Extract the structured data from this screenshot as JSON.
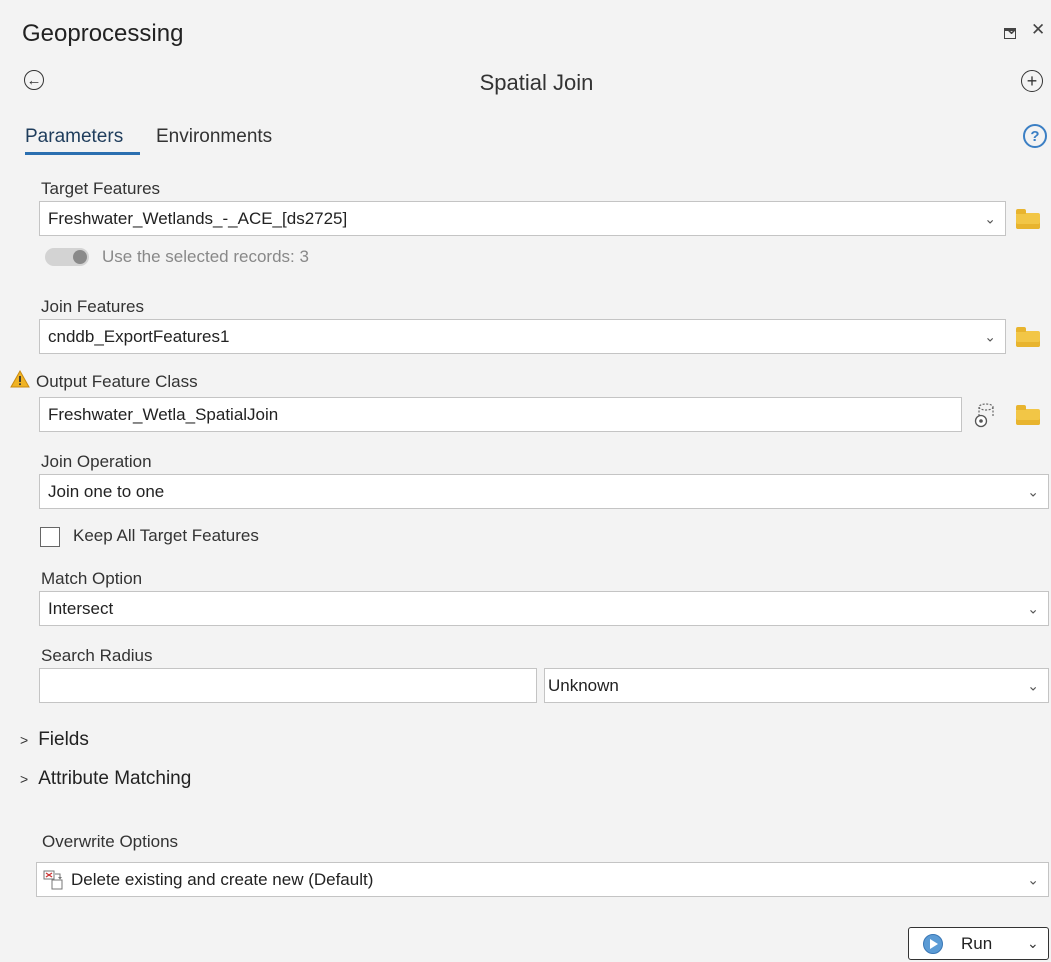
{
  "pane": {
    "title": "Geoprocessing",
    "controls": {
      "dropdown": "⌄",
      "maximize": "□",
      "close": "✕"
    }
  },
  "tool": {
    "title": "Spatial Join",
    "back_icon": "←",
    "add_icon": "+"
  },
  "tabs": [
    {
      "label": "Parameters",
      "active": true
    },
    {
      "label": "Environments",
      "active": false
    }
  ],
  "help_icon": "?",
  "params": {
    "target_features": {
      "label": "Target Features",
      "value": "Freshwater_Wetlands_-_ACE_[ds2725]",
      "toggle_label": "Use the selected records: 3",
      "toggle_on": false
    },
    "join_features": {
      "label": "Join Features",
      "value": "cnddb_ExportFeatures1"
    },
    "output_feature_class": {
      "label": "Output Feature Class",
      "value": "Freshwater_Wetla_SpatialJoin"
    },
    "join_operation": {
      "label": "Join Operation",
      "value": "Join one to one"
    },
    "keep_all": {
      "label": "Keep All Target Features",
      "checked": false
    },
    "match_option": {
      "label": "Match Option",
      "value": "Intersect"
    },
    "search_radius": {
      "label": "Search Radius",
      "value": "",
      "unit": "Unknown"
    }
  },
  "sections": [
    {
      "label": "Fields",
      "expanded": false
    },
    {
      "label": "Attribute Matching",
      "expanded": false
    }
  ],
  "overwrite": {
    "label": "Overwrite Options",
    "value": "Delete existing and create new (Default)"
  },
  "run": {
    "label": "Run"
  },
  "colors": {
    "accent": "#2a6fb0",
    "folder": "#f2c646",
    "warning": "#e8a317",
    "background": "#f3f3f3"
  }
}
